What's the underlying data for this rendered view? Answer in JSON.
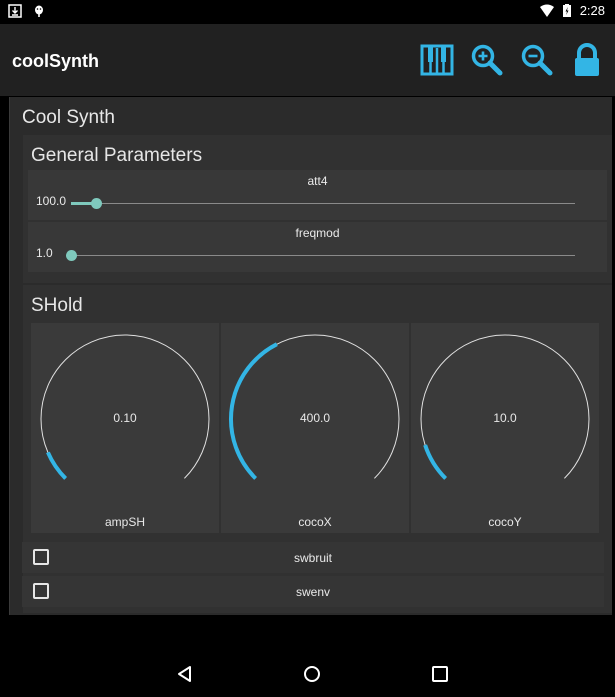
{
  "status_bar": {
    "left_icons": [
      "download-icon",
      "android-icon"
    ],
    "right_icons": [
      "wifi-icon",
      "battery-icon"
    ],
    "time": "2:28"
  },
  "app_bar": {
    "title": "coolSynth",
    "actions": [
      "keyboard-icon",
      "zoom-in-icon",
      "zoom-out-icon",
      "lock-icon"
    ],
    "icon_color": "#33b5e5"
  },
  "main": {
    "title": "Cool Synth",
    "general_parameters": {
      "title": "General Parameters",
      "sliders": [
        {
          "name": "att4",
          "value": "100.0",
          "fraction": 0.05
        },
        {
          "name": "freqmod",
          "value": "1.0",
          "fraction": 0.0
        }
      ]
    },
    "shold": {
      "title": "SHold",
      "knobs": [
        {
          "label": "ampSH",
          "value": "0.10",
          "fraction": 0.08
        },
        {
          "label": "cocoX",
          "value": "400.0",
          "fraction": 0.4
        },
        {
          "label": "cocoY",
          "value": "10.0",
          "fraction": 0.1
        }
      ],
      "checkboxes": [
        {
          "label": "swbruit",
          "checked": false
        },
        {
          "label": "swenv",
          "checked": false
        }
      ]
    }
  },
  "colors": {
    "accent": "#33b5e5",
    "slider": "#7fc9bd",
    "app_bar": "#212121",
    "panel": "#2b2b2b"
  },
  "nav_bar": {
    "buttons": [
      "back-icon",
      "home-icon",
      "recents-icon"
    ]
  }
}
